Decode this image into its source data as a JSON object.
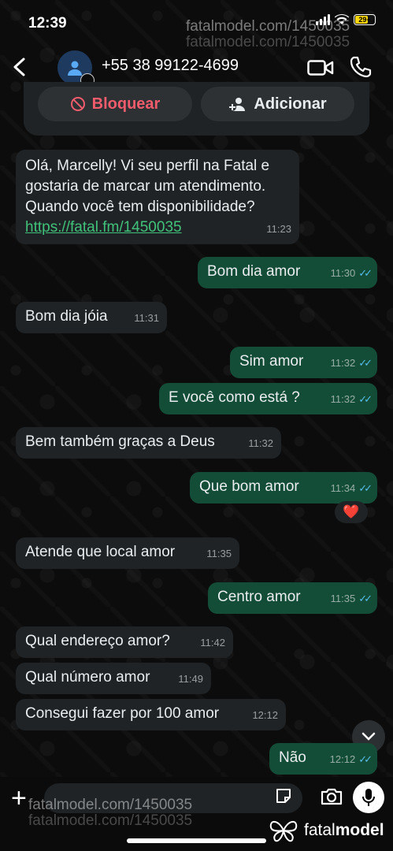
{
  "status": {
    "time": "12:39",
    "battery": "29+"
  },
  "watermark": {
    "text": "fatalmodel.com/1450035"
  },
  "header": {
    "contact": "+55 38 99122-4699"
  },
  "actions": {
    "block_label": "Bloquear",
    "add_label": "Adicionar"
  },
  "messages": [
    {
      "dir": "in",
      "text": "Olá, Marcelly! Vi seu perfil na Fatal e gostaria de marcar um atendimento. Quando você tem disponibilidade?",
      "link": "https://fatal.fm/1450035",
      "time": "11:23"
    },
    {
      "dir": "out",
      "text": "Bom dia amor",
      "time": "11:30"
    },
    {
      "dir": "in",
      "text": "Bom dia jóia",
      "time": "11:31"
    },
    {
      "dir": "out",
      "text": "Sim amor",
      "time": "11:32"
    },
    {
      "dir": "out",
      "text": "E você como está ?",
      "time": "11:32"
    },
    {
      "dir": "in",
      "text": "Bem também graças a Deus",
      "time": "11:32"
    },
    {
      "dir": "out",
      "text": "Que bom amor",
      "time": "11:34",
      "reaction": "❤️"
    },
    {
      "dir": "in",
      "text": "Atende que local amor",
      "time": "11:35"
    },
    {
      "dir": "out",
      "text": "Centro amor",
      "time": "11:35"
    },
    {
      "dir": "in",
      "text": "Qual endereço amor?",
      "time": "11:42"
    },
    {
      "dir": "in",
      "text": "Qual número amor",
      "time": "11:49"
    },
    {
      "dir": "in",
      "text": "Consegui fazer por 100 amor",
      "time": "12:12"
    },
    {
      "dir": "out",
      "text": "Não",
      "time": "12:12"
    }
  ],
  "brand": {
    "name_light": "fatal",
    "name_bold": "model"
  }
}
